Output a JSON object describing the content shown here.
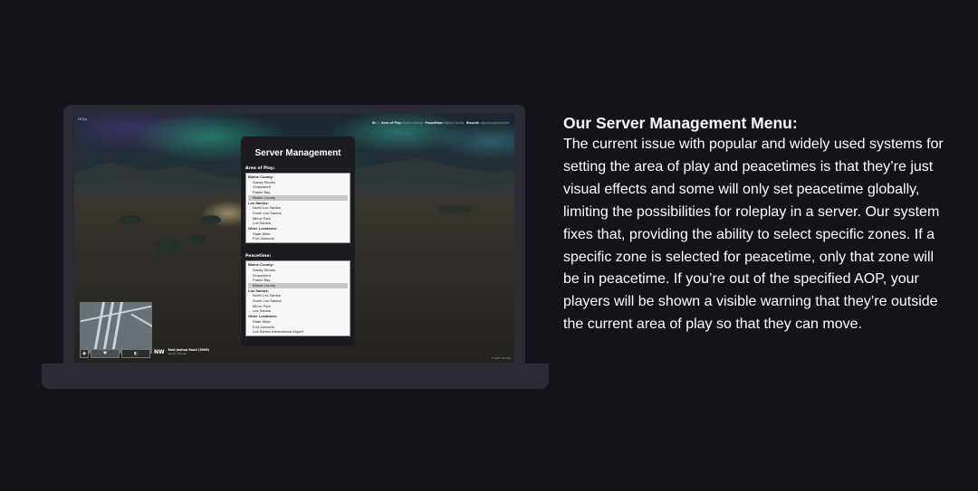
{
  "heading": "Our Server Management Menu:",
  "body": "The current issue with popular and widely used systems for setting the area of play and peacetimes is that they’re just visual effects and some will only set peacetime globally, limiting the possibilities for roleplay in a server. Our system fixes that, providing the ability to select specific zones. If a specific zone is selected for peacetime, only that zone will be in peacetime. If you’re out of the specified AOP, your players will be shown a visible warning that they’re outside the current area of play so that they can move.",
  "game": {
    "top_left": "FRTps",
    "top_right": {
      "id_label": "ID:",
      "id_value": "1",
      "aop_label": "Area of Play:",
      "aop_value": "Blaine County",
      "peace_label": "Peacetime:",
      "peace_value": "Blaine County",
      "discord_label": "Discord:",
      "discord_value": "discord.gg/example"
    },
    "bottom_right": "FiveM Studios",
    "street": {
      "direction": "NW",
      "name": "East Joshua Road (3006)",
      "area": "Sandy Shores"
    },
    "hud_buttons": [
      "◆",
      "♥",
      "◐"
    ]
  },
  "panel": {
    "title": "Server Management",
    "aop_label": "Area of Play:",
    "aop_options": [
      {
        "text": "Blaine County:",
        "type": "group"
      },
      {
        "text": "Sandy Shores",
        "type": "child"
      },
      {
        "text": "Grapeseed",
        "type": "child"
      },
      {
        "text": "Paleto Bay",
        "type": "child"
      },
      {
        "text": "Blaine County",
        "type": "child",
        "selected": true
      },
      {
        "text": "Los Santos:",
        "type": "group"
      },
      {
        "text": "North Los Santos",
        "type": "child"
      },
      {
        "text": "South Los Santos",
        "type": "child"
      },
      {
        "text": "Mirror Park",
        "type": "child"
      },
      {
        "text": "Los Santos",
        "type": "child"
      },
      {
        "text": "Other Locations:",
        "type": "group"
      },
      {
        "text": "State Wide",
        "type": "child"
      },
      {
        "text": "Fort Zancudo",
        "type": "child"
      }
    ],
    "peace_label": "Peacetime:",
    "peace_options": [
      {
        "text": "Blaine County:",
        "type": "group"
      },
      {
        "text": "Sandy Shores",
        "type": "child"
      },
      {
        "text": "Grapeseed",
        "type": "child"
      },
      {
        "text": "Paleto Bay",
        "type": "child"
      },
      {
        "text": "Blaine County",
        "type": "child",
        "selected": true
      },
      {
        "text": "Los Santos:",
        "type": "group"
      },
      {
        "text": "North Los Santos",
        "type": "child"
      },
      {
        "text": "South Los Santos",
        "type": "child"
      },
      {
        "text": "Mirror Park",
        "type": "child"
      },
      {
        "text": "Los Santos",
        "type": "child"
      },
      {
        "text": "Other Locations:",
        "type": "group"
      },
      {
        "text": "State Wide",
        "type": "child"
      },
      {
        "text": "Fort Zancudo",
        "type": "child"
      },
      {
        "text": "Los Santos International Airport",
        "type": "child"
      }
    ]
  }
}
